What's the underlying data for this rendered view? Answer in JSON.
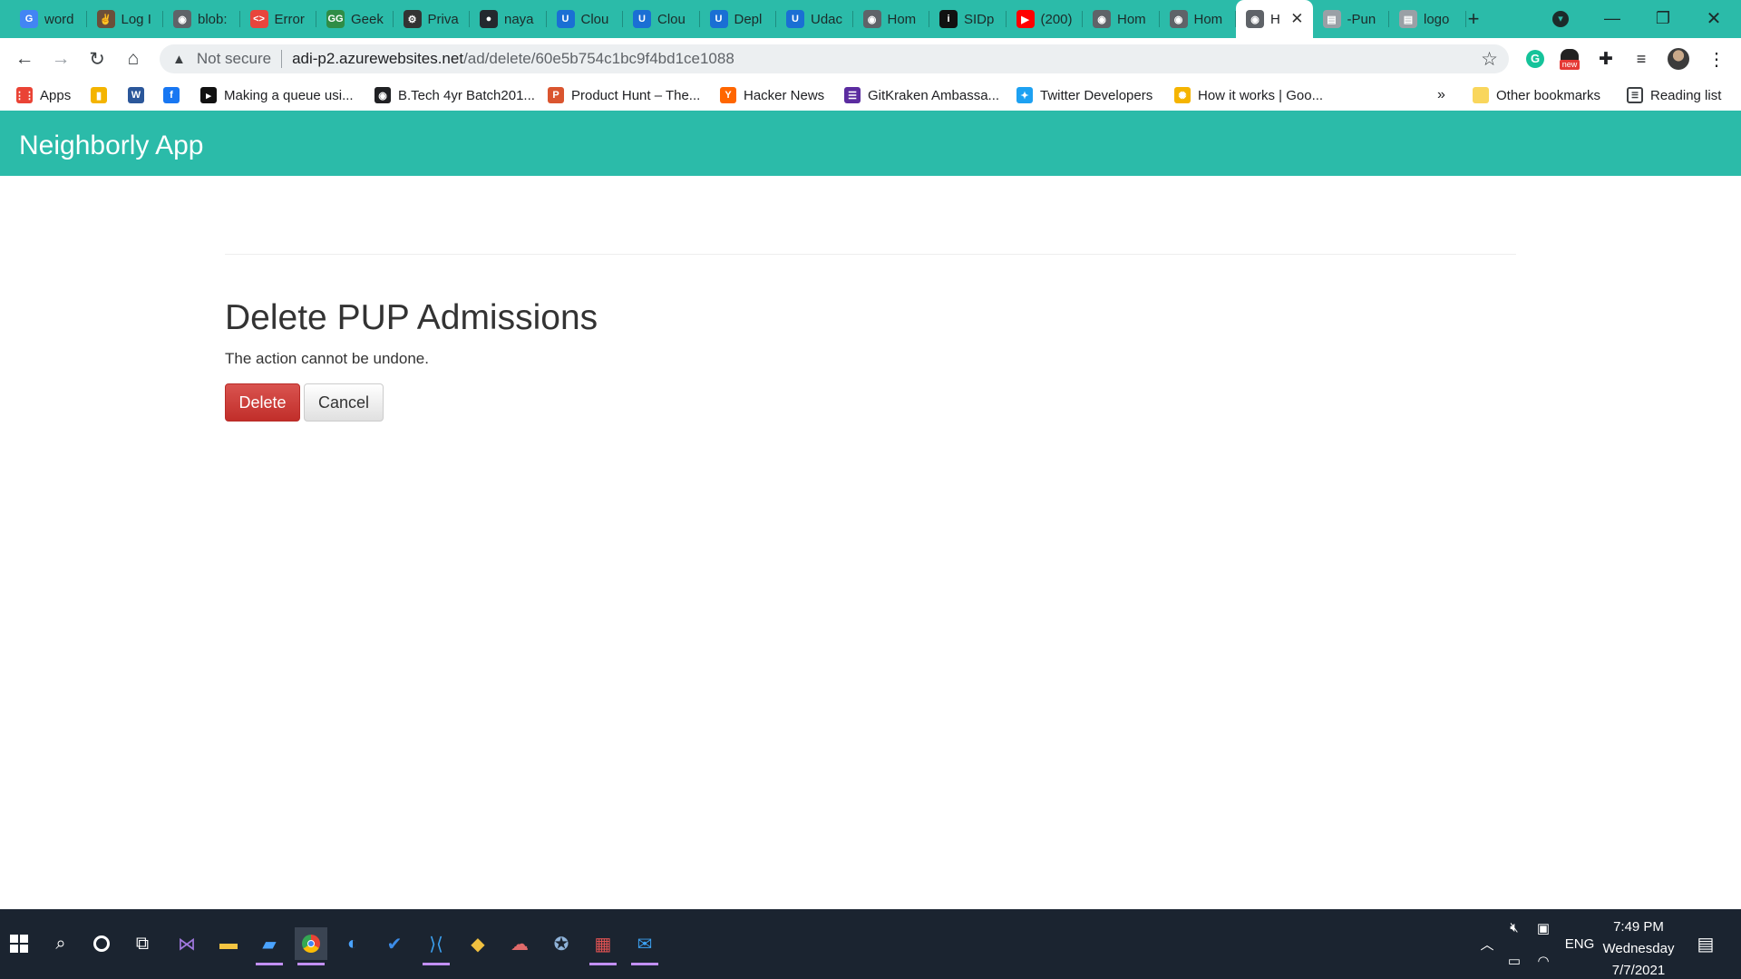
{
  "browser": {
    "tabs": [
      {
        "title": "word",
        "icon": "google-icon",
        "color": "#4285f4",
        "glyph": "G",
        "active": false
      },
      {
        "title": "Log I",
        "icon": "hand-icon",
        "color": "#6b4f3a",
        "glyph": "✌",
        "active": false
      },
      {
        "title": "blob:",
        "icon": "globe-icon",
        "color": "#5f6368",
        "glyph": "◉",
        "active": false
      },
      {
        "title": "Error",
        "icon": "code-icon",
        "color": "#e8453c",
        "glyph": "<>",
        "active": false
      },
      {
        "title": "Geek",
        "icon": "geeksforgeeks-icon",
        "color": "#2f8d46",
        "glyph": "GG",
        "active": false
      },
      {
        "title": "Priva",
        "icon": "gear-icon",
        "color": "#333333",
        "glyph": "⚙",
        "active": false
      },
      {
        "title": "naya",
        "icon": "github-icon",
        "color": "#24292e",
        "glyph": "●",
        "active": false
      },
      {
        "title": "Clou",
        "icon": "udacity-icon",
        "color": "#1a6fd4",
        "glyph": "U",
        "active": false
      },
      {
        "title": "Clou",
        "icon": "udacity-icon",
        "color": "#1a6fd4",
        "glyph": "U",
        "active": false
      },
      {
        "title": "Depl",
        "icon": "udacity-icon",
        "color": "#1a6fd4",
        "glyph": "U",
        "active": false
      },
      {
        "title": "Udac",
        "icon": "udacity-icon",
        "color": "#1a6fd4",
        "glyph": "U",
        "active": false
      },
      {
        "title": "Hom",
        "icon": "globe-icon",
        "color": "#5f6368",
        "glyph": "◉",
        "active": false
      },
      {
        "title": "SIDp",
        "icon": "info-icon",
        "color": "#111111",
        "glyph": "i",
        "active": false
      },
      {
        "title": "(200)",
        "icon": "youtube-icon",
        "color": "#ff0000",
        "glyph": "▶",
        "active": false
      },
      {
        "title": "Hom",
        "icon": "globe-icon",
        "color": "#5f6368",
        "glyph": "◉",
        "active": false
      },
      {
        "title": "Hom",
        "icon": "globe-icon",
        "color": "#5f6368",
        "glyph": "◉",
        "active": false
      },
      {
        "title": "H",
        "icon": "globe-icon",
        "color": "#5f6368",
        "glyph": "◉",
        "active": true
      },
      {
        "title": "-Pun",
        "icon": "file-icon",
        "color": "#9aa0a6",
        "glyph": "▤",
        "active": false
      },
      {
        "title": "logo",
        "icon": "file-icon",
        "color": "#9aa0a6",
        "glyph": "▤",
        "active": false
      }
    ],
    "new_tab_glyph": "+",
    "address": {
      "security_label": "Not secure",
      "host": "adi-p2.azurewebsites.net",
      "path": "/ad/delete/60e5b754c1bc9f4bd1ce1088"
    },
    "extensions": {
      "badge_new": "new"
    },
    "bookmarks": [
      {
        "label": "Apps",
        "icon": "apps-grid-icon",
        "color": "#ea4335",
        "glyph": "⋮⋮"
      },
      {
        "label": "",
        "icon": "analytics-icon",
        "color": "#f4b400",
        "glyph": "▮"
      },
      {
        "label": "",
        "icon": "word-icon",
        "color": "#2b579a",
        "glyph": "W"
      },
      {
        "label": "",
        "icon": "facebook-icon",
        "color": "#1877f2",
        "glyph": "f"
      },
      {
        "label": "Making a queue usi...",
        "icon": "dev-icon",
        "color": "#111111",
        "glyph": "▸"
      },
      {
        "label": "B.Tech 4yr Batch201...",
        "icon": "globe-icon",
        "color": "#202124",
        "glyph": "◉"
      },
      {
        "label": "Product Hunt – The...",
        "icon": "producthunt-icon",
        "color": "#da552f",
        "glyph": "P"
      },
      {
        "label": "Hacker News",
        "icon": "hackernews-icon",
        "color": "#ff6600",
        "glyph": "Y"
      },
      {
        "label": "GitKraken Ambassa...",
        "icon": "list-icon",
        "color": "#5b2ca0",
        "glyph": "☰"
      },
      {
        "label": "Twitter Developers",
        "icon": "twitter-icon",
        "color": "#1da1f2",
        "glyph": "✦"
      },
      {
        "label": "How it works | Goo...",
        "icon": "sun-icon",
        "color": "#f5b400",
        "glyph": "✺"
      }
    ],
    "overflow_glyph": "»",
    "other_bookmarks": "Other bookmarks",
    "reading_list": "Reading list"
  },
  "app": {
    "brand": "Neighborly App",
    "title": "Delete PUP Admissions",
    "subtitle": "The action cannot be undone.",
    "delete_label": "Delete",
    "cancel_label": "Cancel"
  },
  "taskbar": {
    "language": "ENG",
    "time": "7:49 PM",
    "day": "Wednesday",
    "date": "7/7/2021"
  }
}
